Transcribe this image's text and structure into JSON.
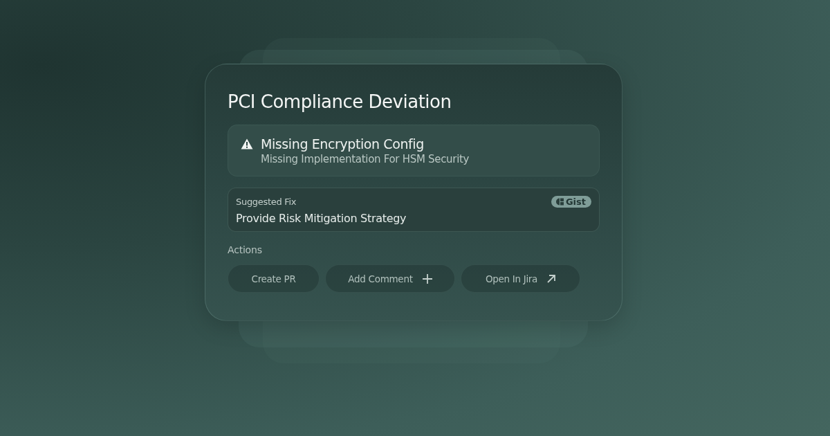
{
  "card": {
    "title": "PCI Compliance Deviation"
  },
  "alert": {
    "title": "Missing Encryption Config",
    "description": "Missing Implementation For HSM Security"
  },
  "suggested_fix": {
    "label": "Suggested Fix",
    "badge": "Gist",
    "text": "Provide Risk Mitigation Strategy"
  },
  "actions": {
    "label": "Actions",
    "buttons": [
      {
        "label": "Create PR",
        "kind": "plain"
      },
      {
        "label": "Add Comment",
        "kind": "add"
      },
      {
        "label": "Open In Jira",
        "kind": "external"
      }
    ]
  }
}
